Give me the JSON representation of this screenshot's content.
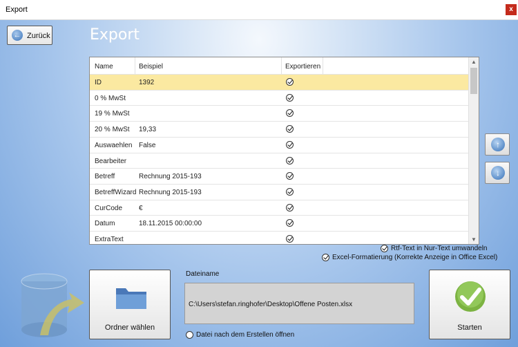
{
  "window": {
    "title": "Export",
    "close_label": "x"
  },
  "header": {
    "back_label": "Zurück",
    "heading": "Export"
  },
  "grid": {
    "columns": [
      "Name",
      "Beispiel",
      "Exportieren"
    ],
    "rows": [
      {
        "name": "ID",
        "example": "1392",
        "export": true,
        "selected": true
      },
      {
        "name": "0 % MwSt",
        "example": "",
        "export": true
      },
      {
        "name": "19 % MwSt",
        "example": "",
        "export": true
      },
      {
        "name": "20 % MwSt",
        "example": "19,33",
        "export": true
      },
      {
        "name": "Auswaehlen",
        "example": "False",
        "export": true
      },
      {
        "name": "Bearbeiter",
        "example": "",
        "export": true
      },
      {
        "name": "Betreff",
        "example": "Rechnung 2015-193",
        "export": true
      },
      {
        "name": "BetreffWizard",
        "example": "Rechnung 2015-193",
        "export": true
      },
      {
        "name": "CurCode",
        "example": "€",
        "export": true
      },
      {
        "name": "Datum",
        "example": "18.11.2015 00:00:00",
        "export": true
      },
      {
        "name": "ExtraText",
        "example": "",
        "export": true
      }
    ]
  },
  "side": {
    "up_icon": "arrow-up-icon",
    "down_icon": "arrow-down-icon"
  },
  "options": {
    "rtf_label": "Rtf-Text in Nur-Text umwandeln",
    "rtf_checked": true,
    "excel_label": "Excel-Formatierung (Korrekte Anzeige in Office Excel)",
    "excel_checked": true
  },
  "folder_button": {
    "label": "Ordner wählen",
    "icon": "folder-icon"
  },
  "file": {
    "label": "Dateiname",
    "value": "C:\\Users\\stefan.ringhofer\\Desktop\\Offene Posten.xlsx",
    "open_after_label": "Datei nach dem Erstellen öffnen",
    "open_after_checked": false
  },
  "start_button": {
    "label": "Starten",
    "icon": "checkmark-icon"
  },
  "colors": {
    "selected_row": "#fbe9a1",
    "accent_green": "#7cb342",
    "close_red": "#c42b1c"
  }
}
